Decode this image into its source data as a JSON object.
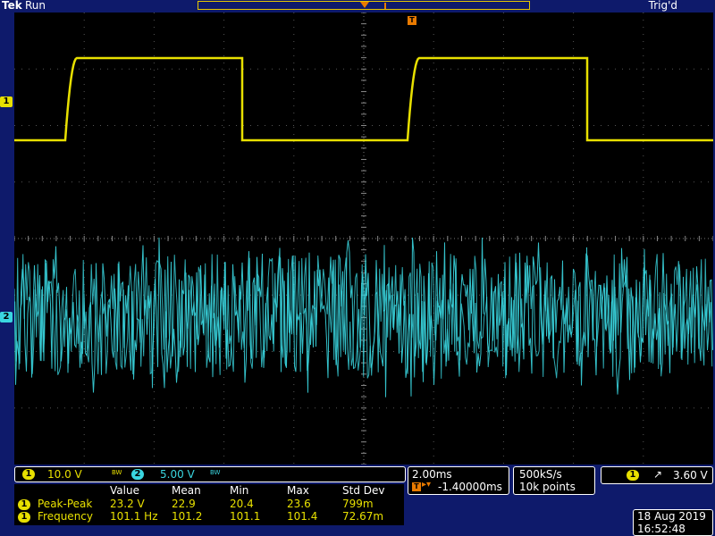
{
  "header": {
    "brand": "Tek",
    "run_state": "Run",
    "trigger_status": "Trig'd"
  },
  "markers": {
    "ch1": "1",
    "ch2": "2",
    "trigger": "T"
  },
  "channels": [
    {
      "id": "1",
      "scale": "10.0 V",
      "color": "#e8e000"
    },
    {
      "id": "2",
      "scale": "5.00 V",
      "color": "#3ad6e0"
    }
  ],
  "bw_symbol": "BW",
  "timebase": {
    "scale": "2.00ms",
    "position": "-1.40000ms"
  },
  "acquisition": {
    "sample_rate": "500kS/s",
    "record_length": "10k points"
  },
  "trigger": {
    "source": "1",
    "slope_symbol": "↗",
    "level": "3.60 V"
  },
  "measurements": {
    "headers": [
      "Value",
      "Mean",
      "Min",
      "Max",
      "Std Dev"
    ],
    "rows": [
      {
        "channel": "1",
        "name": "Peak-Peak",
        "values": [
          "23.2 V",
          "22.9",
          "20.4",
          "23.6",
          "799m"
        ]
      },
      {
        "channel": "1",
        "name": "Frequency",
        "values": [
          "101.1 Hz",
          "101.2",
          "101.1",
          "101.4",
          "72.67m"
        ]
      }
    ]
  },
  "datetime": {
    "date": "18 Aug 2019",
    "time": "16:52:48"
  }
}
